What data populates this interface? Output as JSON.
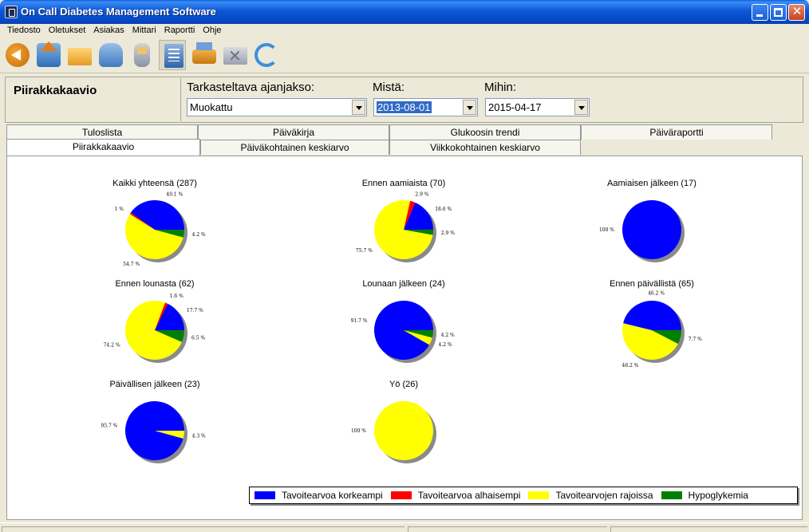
{
  "window": {
    "title": "On Call Diabetes Management Software"
  },
  "menu": [
    "Tiedosto",
    "Oletukset",
    "Asiakas",
    "Mittari",
    "Raportti",
    "Ohje"
  ],
  "toolbar": [
    {
      "icon": "back-arrow-icon",
      "cls": "ic-back"
    },
    {
      "icon": "home-icon",
      "cls": "ic-home"
    },
    {
      "icon": "open-folder-icon",
      "cls": "ic-folder"
    },
    {
      "icon": "patient-icon",
      "cls": "ic-user"
    },
    {
      "icon": "meter-device-icon",
      "cls": "ic-meter"
    },
    {
      "icon": "report-icon",
      "cls": "ic-report",
      "pressed": true
    },
    {
      "icon": "printer-icon",
      "cls": "ic-print"
    },
    {
      "icon": "email-icon",
      "cls": "ic-mail"
    },
    {
      "icon": "sync-icon",
      "cls": "ic-refresh"
    }
  ],
  "header": {
    "section_title": "Piirakkakaavio",
    "period_label": "Tarkasteltava ajanjakso:",
    "period_value": "Muokattu",
    "from_label": "Mistä:",
    "from_value": "2013-08-01",
    "to_label": "Mihin:",
    "to_value": "2015-04-17"
  },
  "tabs": {
    "row1": [
      "Tuloslista",
      "Päiväkirja",
      "Glukoosin trendi",
      "Päiväraportti"
    ],
    "row2": [
      "Piirakkakaavio",
      "Päiväkohtainen keskiarvo",
      "Viikkokohtainen keskiarvo"
    ],
    "active": "Piirakkakaavio"
  },
  "colors": {
    "high": "#0000ff",
    "low": "#ff0000",
    "inrange": "#ffff00",
    "hypo": "#008000"
  },
  "chart_data": {
    "type": "pie",
    "legend": [
      "Tavoitearvoa korkeampi",
      "Tavoitearvoa alhaisempi",
      "Tavoitearvojen rajoissa",
      "Hypoglykemia"
    ],
    "legend_placement": "bottom-right",
    "charts": [
      {
        "title": "Kaikki yhteensä (287)",
        "high": 40.1,
        "hypo": 4.2,
        "inrange": 54.7,
        "low": 1,
        "labels": [
          "40.1 %",
          "4.2 %",
          "54.7 %",
          "1 %"
        ]
      },
      {
        "title": "Ennen aamiaista (70)",
        "high": 18.6,
        "hypo": 2.9,
        "inrange": 75.7,
        "low": 2.9,
        "labels": [
          "18.6 %",
          "2.9 %",
          "75.7 %",
          "2.9 %"
        ]
      },
      {
        "title": "Aamiaisen jälkeen (17)",
        "high": 100,
        "hypo": 0,
        "inrange": 0,
        "low": 0,
        "labels": [
          "100 %",
          "",
          "",
          ""
        ]
      },
      {
        "title": "Ennen lounasta (62)",
        "high": 17.7,
        "hypo": 6.5,
        "inrange": 74.2,
        "low": 1.6,
        "labels": [
          "17.7 %",
          "6.5 %",
          "74.2 %",
          "1.6 %"
        ]
      },
      {
        "title": "Lounaan jälkeen (24)",
        "high": 91.7,
        "hypo": 4.2,
        "inrange": 4.2,
        "low": 0,
        "labels": [
          "91.7 %",
          "4.2 %",
          "4.2 %",
          ""
        ]
      },
      {
        "title": "Ennen päivällistä (65)",
        "high": 46.2,
        "hypo": 7.7,
        "inrange": 46.2,
        "low": 0,
        "labels": [
          "46.2 %",
          "7.7 %",
          "46.2 %",
          ""
        ]
      },
      {
        "title": "Päivällisen jälkeen (23)",
        "high": 95.7,
        "hypo": 0,
        "inrange": 4.3,
        "low": 0,
        "labels": [
          "95.7 %",
          "",
          "4.3 %",
          ""
        ]
      },
      {
        "title": "Yö (26)",
        "high": 0,
        "hypo": 0,
        "inrange": 100,
        "low": 0,
        "labels": [
          "",
          "",
          "100 %",
          ""
        ]
      }
    ]
  }
}
